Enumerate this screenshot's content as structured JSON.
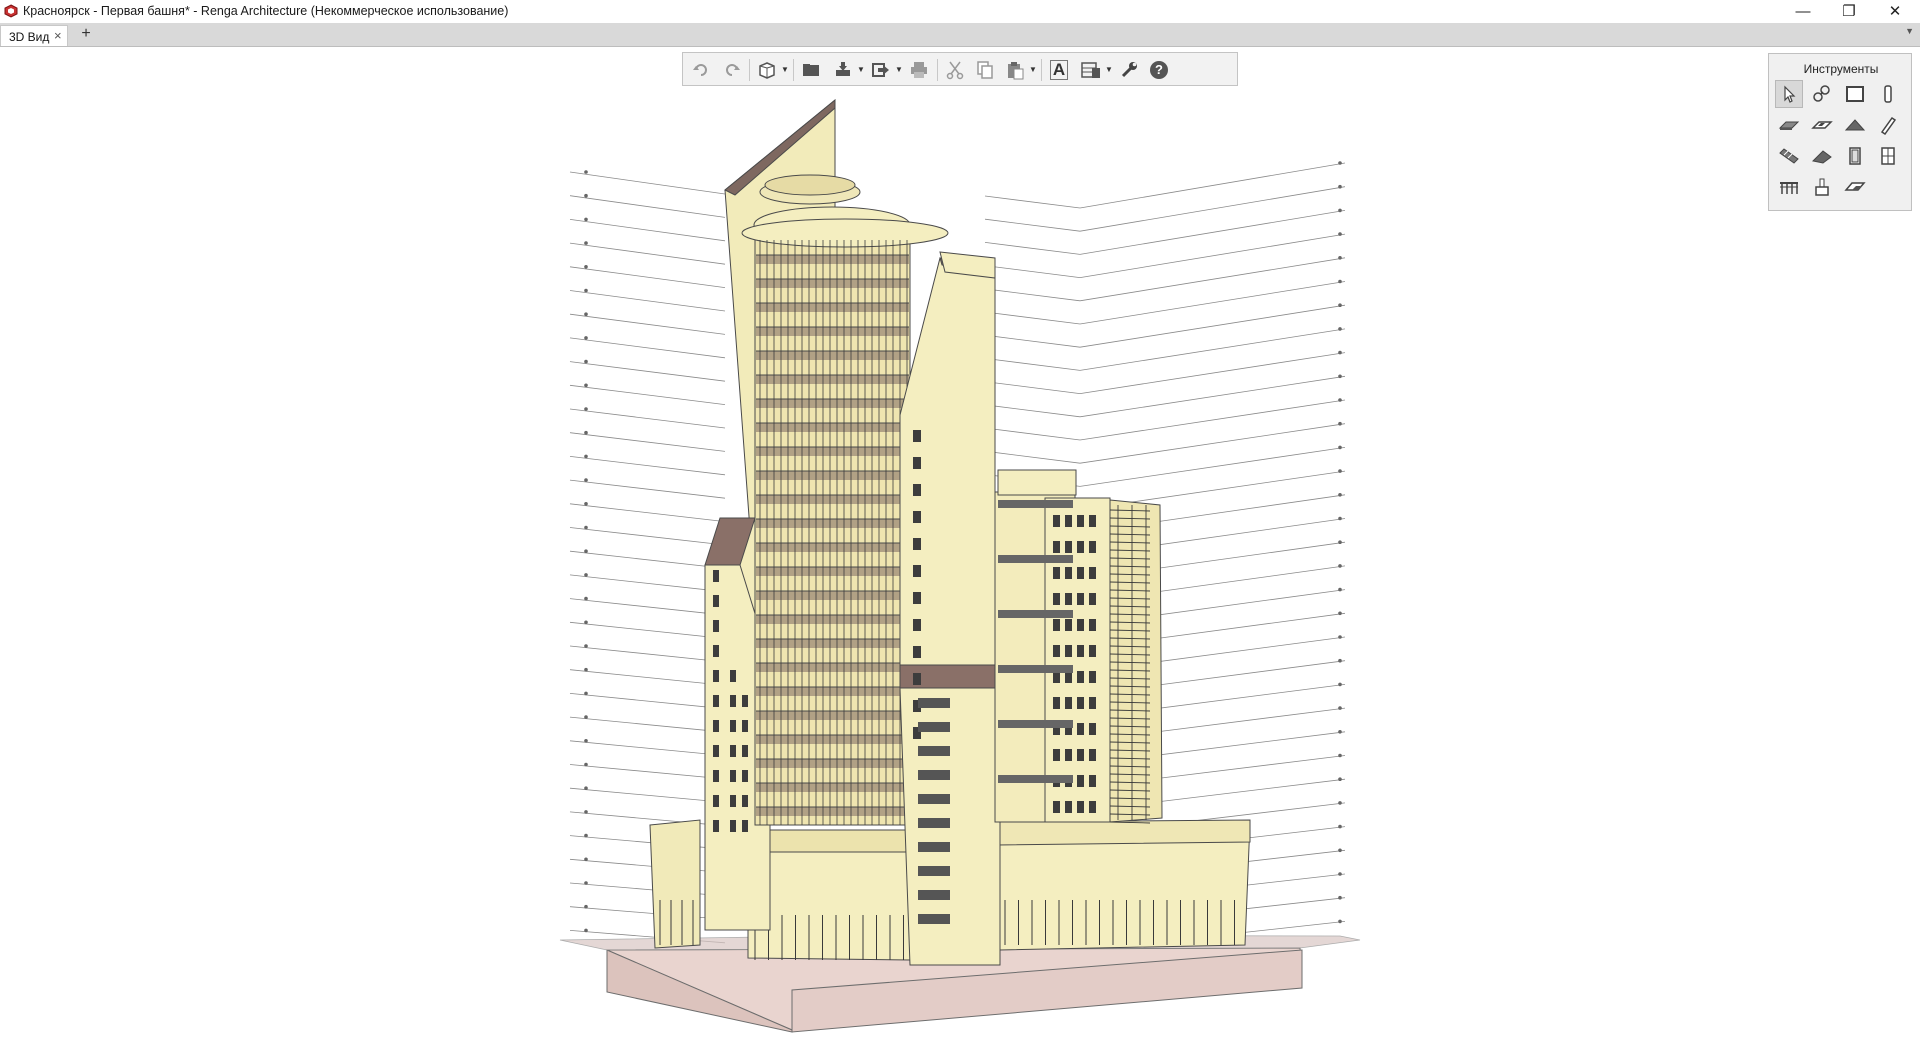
{
  "window": {
    "title": "Красноярск - Первая башня* - Renga Architecture (Некоммерческое использование)",
    "controls": {
      "minimize": "—",
      "restore": "❐",
      "close": "✕"
    }
  },
  "tabs": [
    {
      "label": "3D Вид",
      "close": "×",
      "active": true
    }
  ],
  "add_tab_label": "+",
  "tab_menu_label": "▼",
  "toolbar": {
    "buttons": [
      "undo-icon",
      "redo-icon",
      "view-cube-icon",
      "open-icon",
      "save-icon",
      "export-icon",
      "print-icon",
      "cut-icon",
      "copy-icon",
      "paste-icon",
      "text-style-icon",
      "layers-icon",
      "settings-wrench-icon",
      "help-icon"
    ],
    "help_label": "?",
    "text_label": "A"
  },
  "tools_panel": {
    "title": "Инструменты",
    "tools": [
      "select-icon",
      "grid-axes-icon",
      "wall-icon",
      "column-icon",
      "slab-icon",
      "opening-icon",
      "roof-icon",
      "beam-icon",
      "stair-icon",
      "ramp-icon",
      "door-icon",
      "window-icon",
      "railing-icon",
      "equipment-icon",
      "element-icon"
    ]
  },
  "model": {
    "facade_color": "#f4eec0",
    "roof_color": "#8a7068",
    "base_color": "#e8d0cc",
    "line_color": "#4a4a4a",
    "levels": 33
  }
}
